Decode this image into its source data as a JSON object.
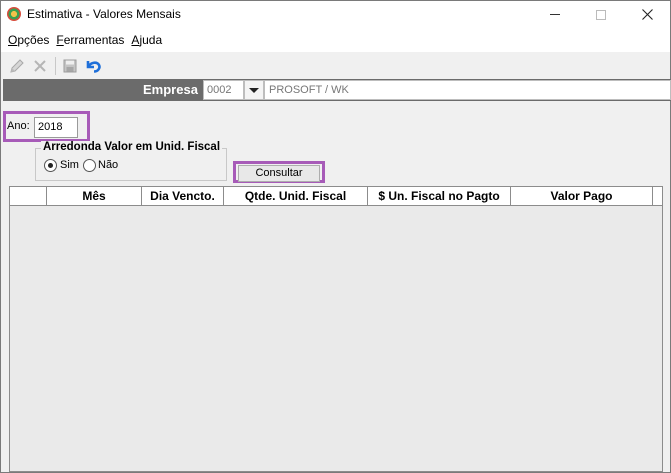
{
  "window": {
    "title": "Estimativa - Valores Mensais"
  },
  "menu": {
    "items": [
      {
        "accel": "O",
        "rest": "pções"
      },
      {
        "accel": "F",
        "rest": "erramentas"
      },
      {
        "accel": "A",
        "rest": "juda"
      }
    ]
  },
  "toolbar": {
    "icons": [
      "edit-icon",
      "delete-icon",
      "save-icon",
      "undo-icon"
    ]
  },
  "empresa": {
    "label": "Empresa",
    "code": "0002",
    "name": "PROSOFT / WK"
  },
  "ano": {
    "label": "Ano:",
    "value": "2018"
  },
  "arredonda": {
    "title": "Arredonda Valor em Unid. Fiscal",
    "options": [
      {
        "label": "Sim",
        "selected": true
      },
      {
        "label": "Não",
        "selected": false
      }
    ]
  },
  "consultar": {
    "label": "Consultar"
  },
  "grid": {
    "columns": [
      "Mês",
      "Dia Vencto.",
      "Qtde. Unid. Fiscal",
      "$ Un. Fiscal no Pagto",
      "Valor Pago"
    ],
    "rows": []
  },
  "colors": {
    "highlight": "#a75bb8",
    "empresa_bar": "#6b6b6b",
    "undo_icon": "#1e6fd9"
  }
}
